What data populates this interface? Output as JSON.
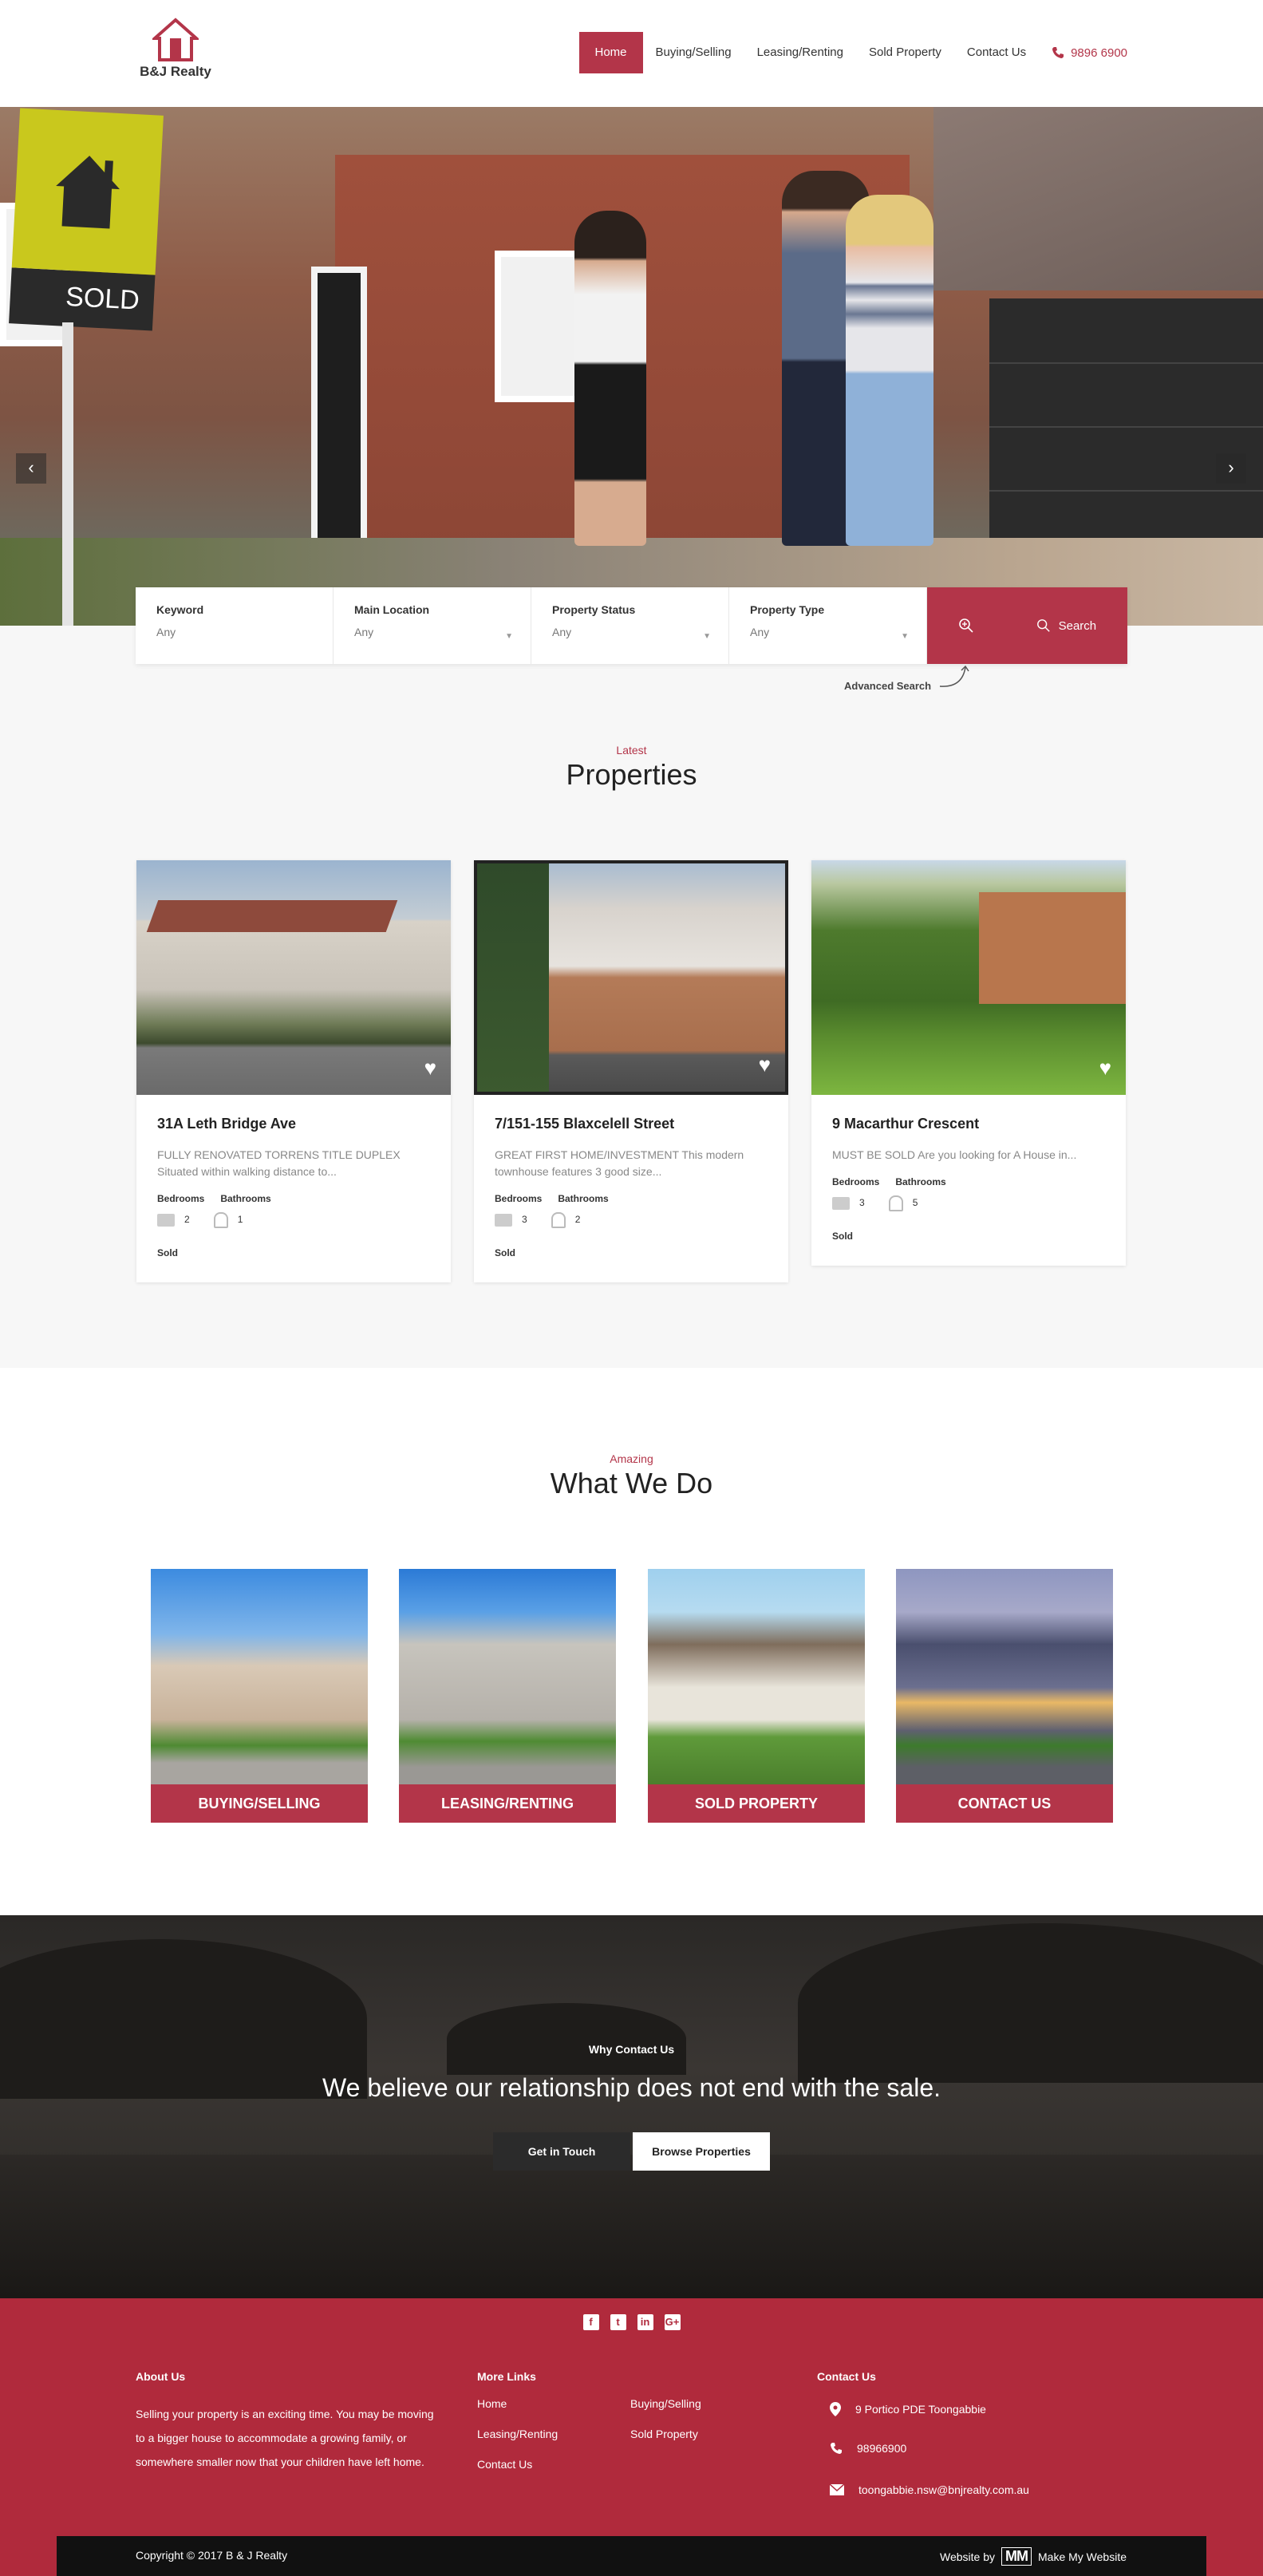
{
  "header": {
    "logo_text": "B&J Realty",
    "nav": [
      "Home",
      "Buying/Selling",
      "Leasing/Renting",
      "Sold Property",
      "Contact Us"
    ],
    "phone": "9896 6900",
    "accent_color": "#b33549"
  },
  "hero": {
    "sign_text": "SOLD",
    "prev_label": "‹",
    "next_label": "›"
  },
  "search": {
    "fields": [
      {
        "label": "Keyword",
        "value": "Any"
      },
      {
        "label": "Main Location",
        "value": "Any"
      },
      {
        "label": "Property Status",
        "value": "Any"
      },
      {
        "label": "Property Type",
        "value": "Any"
      }
    ],
    "button_label": "Search",
    "advanced_label": "Advanced Search"
  },
  "latest": {
    "kicker": "Latest",
    "title": "Properties",
    "cards": [
      {
        "title": "31A Leth Bridge Ave",
        "desc": "FULLY RENOVATED TORRENS TITLE DUPLEX Situated within walking distance to...",
        "bedrooms_label": "Bedrooms",
        "bathrooms_label": "Bathrooms",
        "bedrooms": "2",
        "bathrooms": "1",
        "status": "Sold"
      },
      {
        "title": "7/151-155 Blaxcelell Street",
        "desc": "GREAT FIRST HOME/INVESTMENT This modern townhouse features 3 good size...",
        "bedrooms_label": "Bedrooms",
        "bathrooms_label": "Bathrooms",
        "bedrooms": "3",
        "bathrooms": "2",
        "status": "Sold"
      },
      {
        "title": "9 Macarthur Crescent",
        "desc": "MUST BE SOLD Are you looking for  A House in...",
        "bedrooms_label": "Bedrooms",
        "bathrooms_label": "Bathrooms",
        "bedrooms": "3",
        "bathrooms": "5",
        "status": "Sold"
      }
    ]
  },
  "what_we_do": {
    "kicker": "Amazing",
    "title": "What We Do",
    "items": [
      "BUYING/SELLING",
      "LEASING/RENTING",
      "SOLD PROPERTY",
      "CONTACT US"
    ]
  },
  "why": {
    "kicker": "Why Contact Us",
    "title": "We believe our relationship does not end with the sale.",
    "btn_primary": "Get in Touch",
    "btn_secondary": "Browse Properties"
  },
  "footer": {
    "social": [
      "f",
      "t",
      "in",
      "G+"
    ],
    "about_title": "About Us",
    "about_text": "Selling your property is an exciting time. You may be moving to a bigger house to accommodate a growing family, or somewhere smaller now that your children have left home.",
    "links_title": "More Links",
    "links": [
      "Home",
      "Leasing/Renting",
      "Contact Us",
      "Buying/Selling",
      "Sold Property"
    ],
    "contact_title": "Contact Us",
    "address": "9 Portico PDE Toongabbie",
    "phone": "98966900",
    "email": "toongabbie.nsw@bnjrealty.com.au",
    "copyright": "Copyright © 2017 B & J Realty",
    "website_by": "Website by",
    "maker_logo": "MM",
    "maker": "Make My Website",
    "bg_color": "#b02a3c"
  }
}
